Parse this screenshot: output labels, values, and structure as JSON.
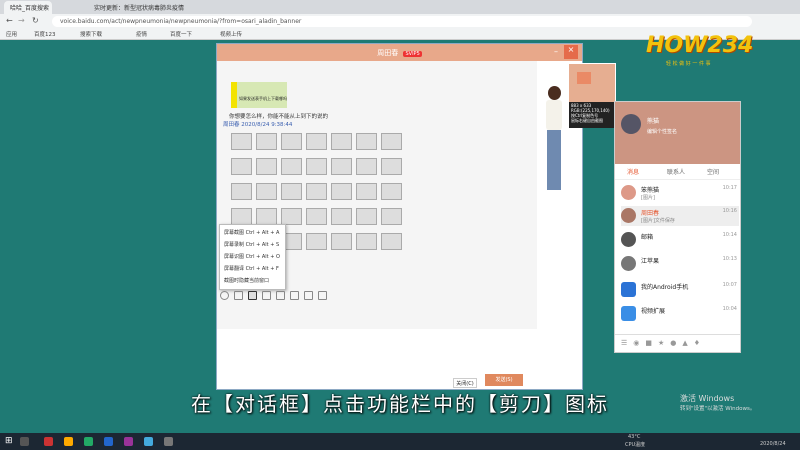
{
  "browser": {
    "tabs": [
      "哈哈_百度搜索",
      "实时更新：新型冠状病毒肺炎疫情"
    ],
    "url": "voice.baidu.com/act/newpneumonia/newpneumonia/?from=osari_aladin_banner",
    "bookmarks": [
      "应用",
      "百度123",
      "搜索下载",
      "疫情",
      "百度一下",
      "视频上传"
    ]
  },
  "chat": {
    "title": "周田春",
    "badge": "SVIP5",
    "sender": "周田春 2020/8/24 9:38:44",
    "message": "你想要怎么样，你能不能从上到下的说的",
    "bubble": "如果发送表手机上下载哪吗",
    "close_label": "关闭(C)",
    "send_label": "发送(S)"
  },
  "context_menu": {
    "items": [
      "屏幕截图 Ctrl + Alt + A",
      "屏幕录制 Ctrl + Alt + S",
      "屏幕识图 Ctrl + Alt + O",
      "屏幕翻译 Ctrl + Alt + F",
      "截图时隐藏当前窗口"
    ]
  },
  "capture_tip": {
    "size": "883 x 633",
    "rgb": "RGB:(225,170,140)",
    "hint1": "按Ctrl复制色号",
    "hint2": "鼠标右键自由截图"
  },
  "contacts": {
    "user": "熊猫",
    "sign": "编辑个性签名",
    "tabs": [
      "消息",
      "联系人",
      "空间"
    ],
    "items": [
      {
        "name": "笨熊猫",
        "msg": "[图片]",
        "time": "10:17"
      },
      {
        "name": "周田春",
        "msg": "[图片]文件保存",
        "time": "10:16"
      },
      {
        "name": "邮箱",
        "msg": "",
        "time": "10:14"
      },
      {
        "name": "江苹果",
        "msg": "",
        "time": "10:13"
      },
      {
        "name": "我的Android手机",
        "msg": "",
        "time": "10:07"
      },
      {
        "name": "视频扩展",
        "msg": "",
        "time": "10:04"
      }
    ]
  },
  "watermark": {
    "logo": "HOW234",
    "sub": "轻 松 做 好 一 件 事"
  },
  "activate": {
    "line1": "激活 Windows",
    "line2": "转到\"设置\"以激活 Windows。"
  },
  "caption": "在【对话框】点击功能栏中的【剪刀】图标",
  "taskbar": {
    "temp": "43°C",
    "cpu": "CPU温度",
    "date": "2020/8/24"
  }
}
